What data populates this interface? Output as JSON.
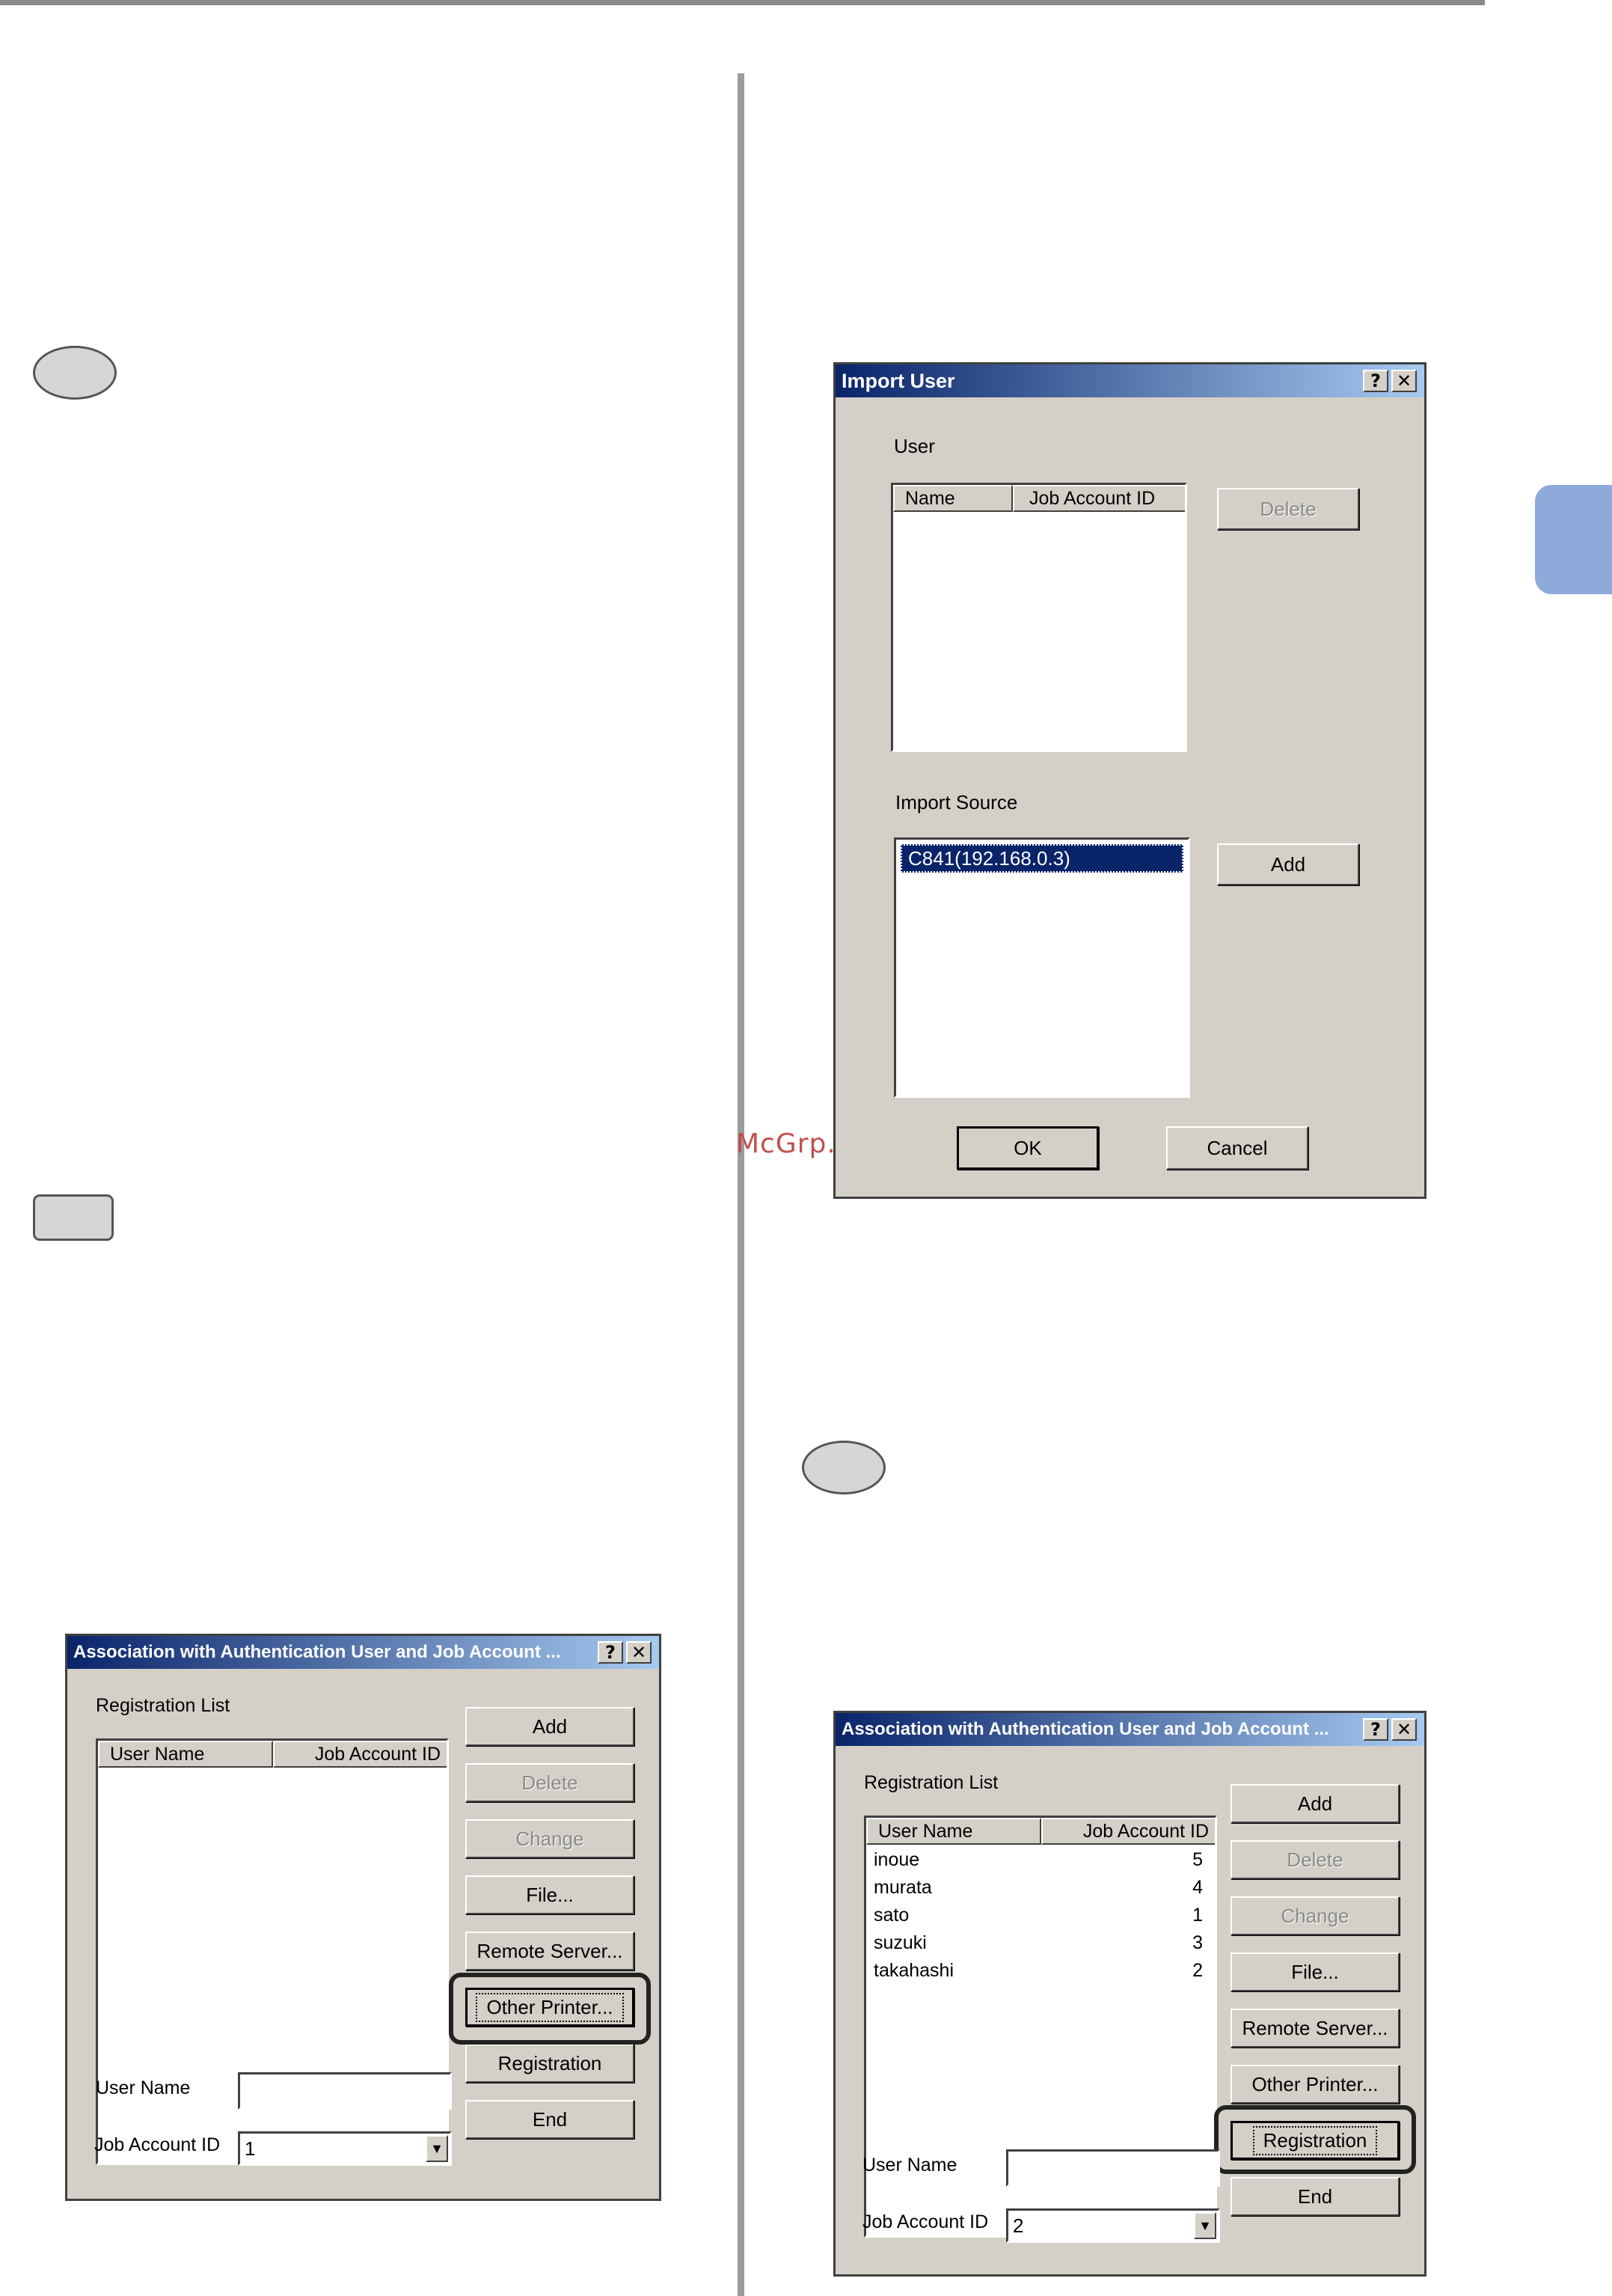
{
  "watermark": "McGrp.Ru",
  "import_dialog": {
    "title": "Import User",
    "help_btn": "?",
    "close_btn": "✕",
    "user_label": "User",
    "col_name": "Name",
    "col_job": "Job Account ID",
    "delete_label": "Delete",
    "source_label": "Import Source",
    "source_item": "C841(192.168.0.3)",
    "add_label": "Add",
    "ok_label": "OK",
    "cancel_label": "Cancel"
  },
  "assoc_dialog_1": {
    "title": "Association with Authentication User and Job Account ...",
    "help_btn": "?",
    "close_btn": "✕",
    "list_label": "Registration List",
    "col_user": "User Name",
    "col_job": "Job Account ID",
    "buttons": {
      "add": "Add",
      "delete": "Delete",
      "change": "Change",
      "file": "File...",
      "remote": "Remote Server...",
      "other": "Other Printer...",
      "registration": "Registration",
      "end": "End"
    },
    "username_label": "User Name",
    "username_value": "",
    "jobid_label": "Job Account ID",
    "jobid_value": "1"
  },
  "assoc_dialog_2": {
    "title": "Association with Authentication User and Job Account ...",
    "help_btn": "?",
    "close_btn": "✕",
    "list_label": "Registration List",
    "col_user": "User Name",
    "col_job": "Job Account ID",
    "rows": [
      {
        "name": "inoue",
        "id": "5"
      },
      {
        "name": "murata",
        "id": "4"
      },
      {
        "name": "sato",
        "id": "1"
      },
      {
        "name": "suzuki",
        "id": "3"
      },
      {
        "name": "takahashi",
        "id": "2"
      }
    ],
    "buttons": {
      "add": "Add",
      "delete": "Delete",
      "change": "Change",
      "file": "File...",
      "remote": "Remote Server...",
      "other": "Other Printer...",
      "registration": "Registration",
      "end": "End"
    },
    "username_label": "User Name",
    "username_value": "",
    "jobid_label": "Job Account ID",
    "jobid_value": "2"
  }
}
